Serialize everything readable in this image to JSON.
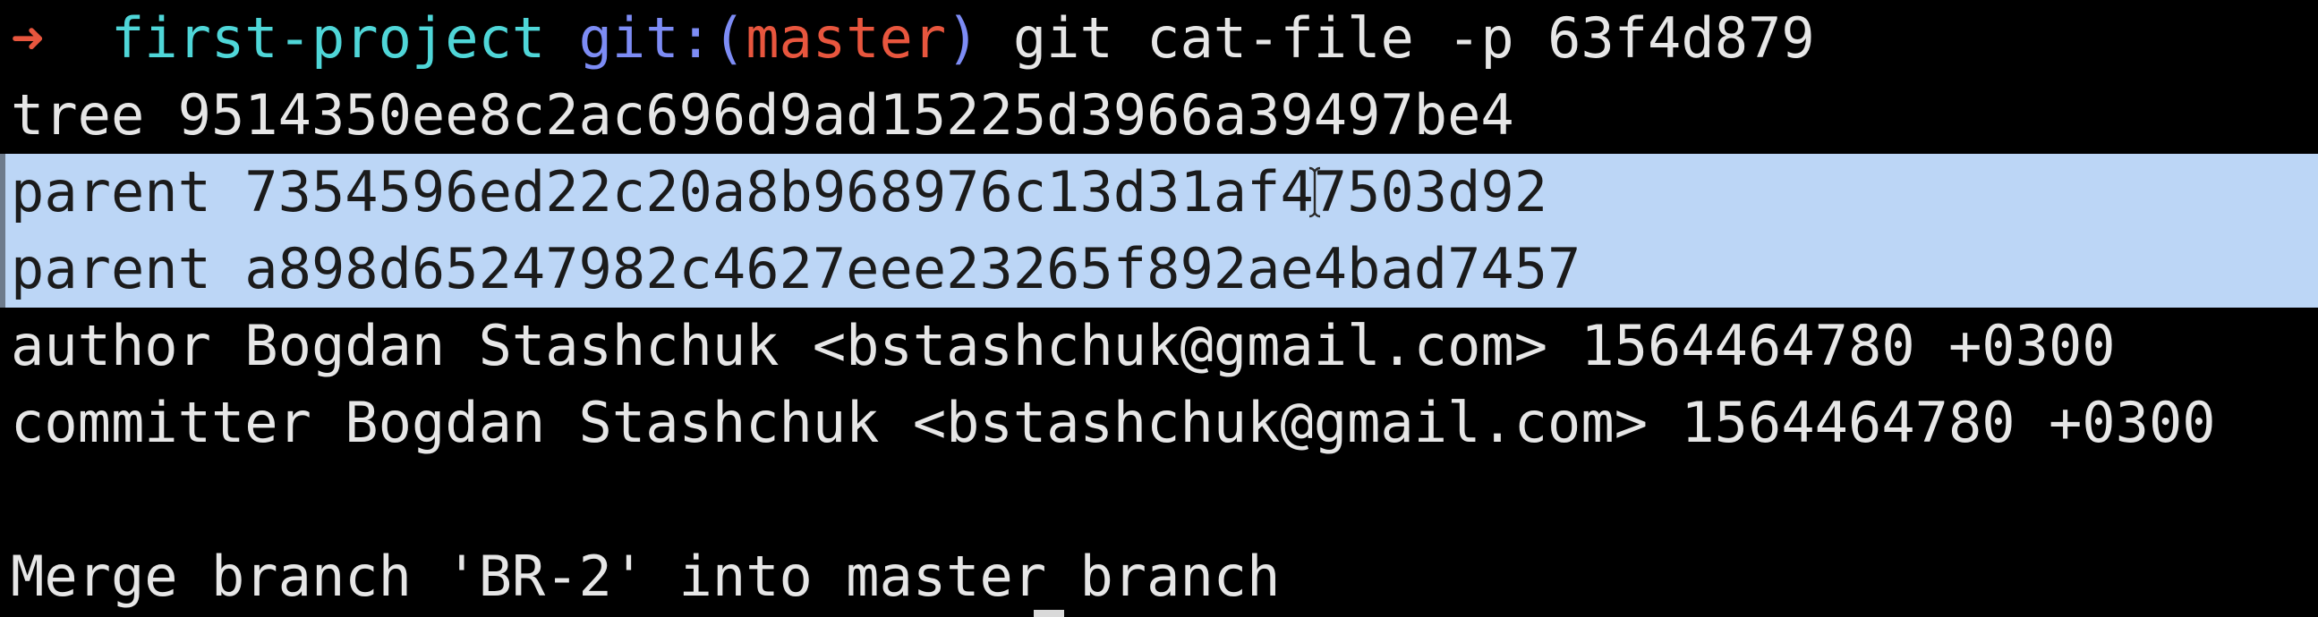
{
  "terminal": {
    "prompt": {
      "arrow": "➜",
      "directory": "first-project",
      "git_prefix": "git:(",
      "branch": "master",
      "git_suffix": ")",
      "command": "git cat-file -p 63f4d879"
    },
    "output": {
      "tree": "tree 9514350ee8c2ac696d9ad15225d3966a39497be4",
      "parent_1_prefix": "parent 7354596ed22c20a8b968976c13d31af",
      "parent_1_suffix": "47503d92",
      "parent_2": "parent a898d65247982c4627eee23265f892ae4bad7457",
      "author": "author Bogdan Stashchuk <bstashchuk@gmail.com> 1564464780 +0300",
      "committer": "committer Bogdan Stashchuk <bstashchuk@gmail.com> 1564464780 +0300",
      "blank": "",
      "message": "Merge branch 'BR-2' into master branch"
    },
    "colors": {
      "background": "#000000",
      "text": "#e6e6e6",
      "prompt_arrow": "#e8563e",
      "directory": "#4fd6d8",
      "git_label": "#7d8cf5",
      "branch": "#e8563e",
      "selection": "#bcd6f6"
    },
    "icons": {
      "text_cursor": "i-beam-cursor-icon"
    }
  }
}
